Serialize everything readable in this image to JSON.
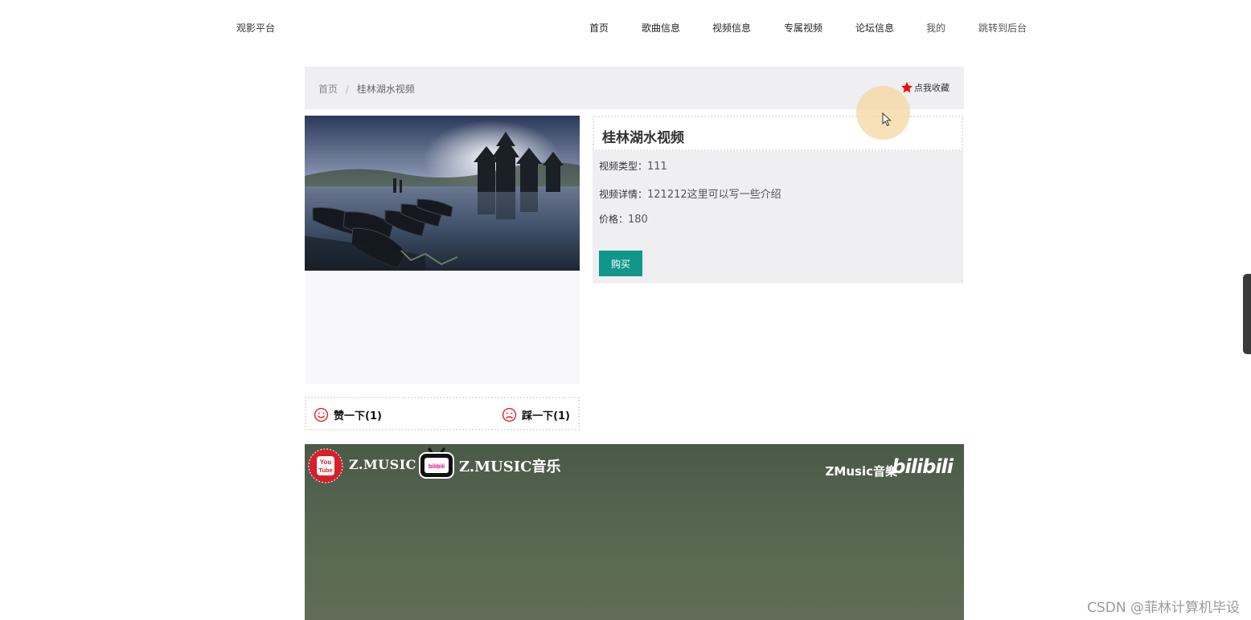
{
  "header": {
    "site_title": "观影平台",
    "nav": [
      {
        "label": "首页"
      },
      {
        "label": "歌曲信息"
      },
      {
        "label": "视频信息"
      },
      {
        "label": "专属视频"
      },
      {
        "label": "论坛信息"
      },
      {
        "label": "我的"
      },
      {
        "label": "跳转到后台"
      }
    ]
  },
  "breadcrumb": {
    "home": "首页",
    "separator": "/",
    "current": "桂林湖水视频"
  },
  "favorite": {
    "label": "点我收藏",
    "star_color": "#ff0000"
  },
  "detail": {
    "title": "桂林湖水视频",
    "type_label": "视频类型：",
    "type_value": "111",
    "desc_label": "视频详情：",
    "desc_value": "121212这里可以写一些介绍",
    "price_label": "价格：",
    "price_value": "180",
    "buy_label": "购买",
    "buy_color": "#12968a"
  },
  "votes": {
    "like_label": "赞一下(1)",
    "dislike_label": "踩一下(1)",
    "icon_color": "#e02424"
  },
  "video": {
    "brand_left": "Z.MUSIC",
    "brand_mid": "Z.MUSIC音乐",
    "brand_right": "ZMusic音樂",
    "brand_bili": "bilibili",
    "youtube_text_1": "You",
    "youtube_text_2": "Tube",
    "bili_badge": "bilibili"
  },
  "watermark": "CSDN @菲林计算机毕设"
}
